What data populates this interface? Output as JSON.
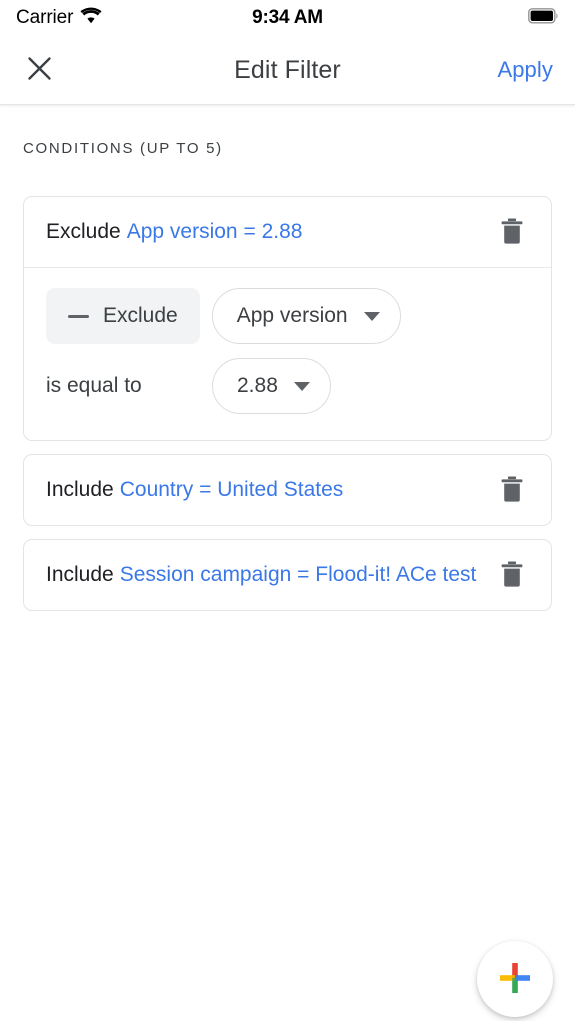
{
  "status_bar": {
    "carrier": "Carrier",
    "time": "9:34 AM",
    "wifi_icon": "wifi-icon",
    "battery_icon": "battery-full-icon"
  },
  "app_bar": {
    "close_icon": "close-icon",
    "title": "Edit Filter",
    "apply_label": "Apply"
  },
  "section": {
    "label": "CONDITIONS (UP TO 5)"
  },
  "colors": {
    "link_blue": "#3b78e7",
    "text_primary": "#202124",
    "text_secondary": "#3c4043",
    "chip_bg": "#f1f3f4",
    "border": "#dadce0",
    "google_red": "#ea4335",
    "google_yellow": "#fbbc05",
    "google_green": "#34a853",
    "google_blue": "#4285f4"
  },
  "conditions": [
    {
      "mode": "Exclude",
      "dimension": "App version",
      "equals_sign": "=",
      "value": "2.88",
      "delete_icon": "trash-icon",
      "expanded": true,
      "editor": {
        "toggle_label": "Exclude",
        "toggle_icon": "minus-icon",
        "dimension_label": "App version",
        "dimension_caret": "chevron-down-icon",
        "operator_label": "is equal to",
        "value_label": "2.88",
        "value_caret": "chevron-down-icon"
      }
    },
    {
      "mode": "Include",
      "dimension": "Country",
      "equals_sign": "=",
      "value": "United States",
      "delete_icon": "trash-icon",
      "expanded": false
    },
    {
      "mode": "Include",
      "dimension": "Session campaign",
      "equals_sign": "=",
      "value": "Flood-it! ACe test",
      "delete_icon": "trash-icon",
      "expanded": false
    }
  ],
  "fab": {
    "icon": "google-plus-add-icon",
    "label": "Add condition"
  }
}
